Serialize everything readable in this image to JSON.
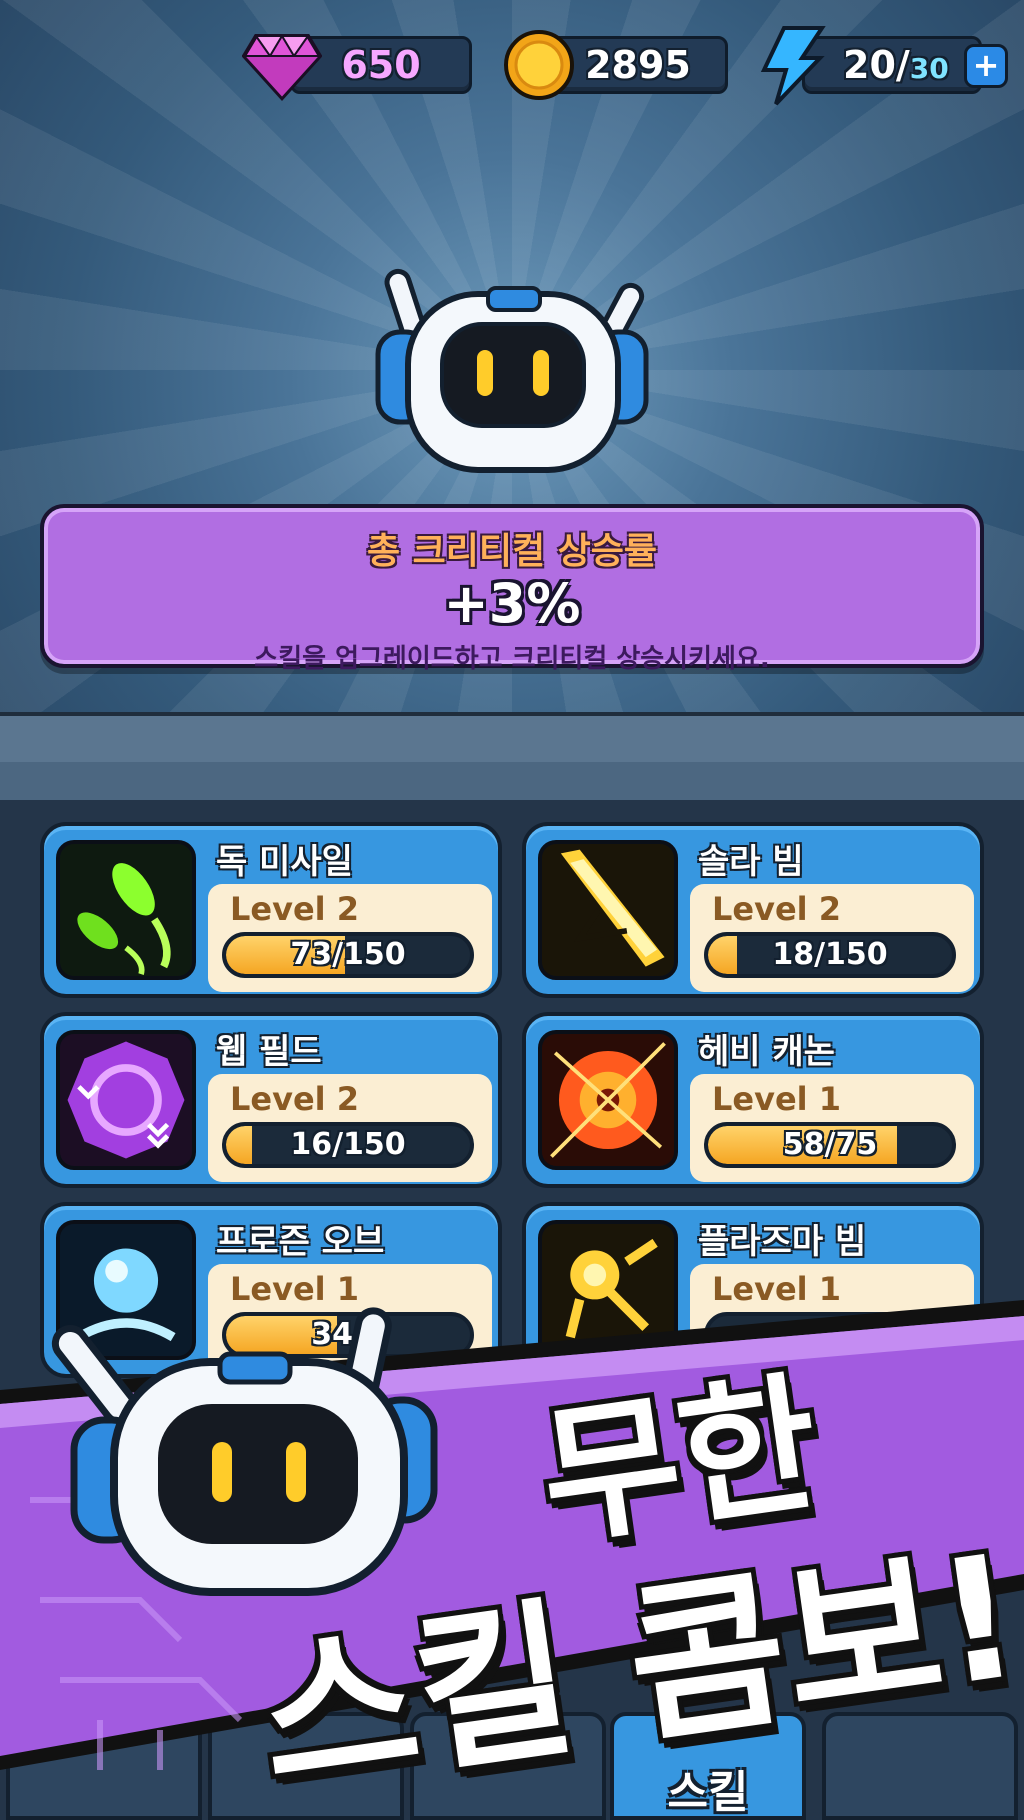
{
  "currency": {
    "gems": "650",
    "coins": "2895",
    "energy_current": "20/",
    "energy_max": "30",
    "plus_label": "+"
  },
  "stat_panel": {
    "title": "총 크리티컬 상승률",
    "value": "+3%",
    "description": "스킬을 업그레이드하고 크리티컬 상승시키세요."
  },
  "skills": [
    {
      "name": "독 미사일",
      "level": "Level 2",
      "progress_text": "73/150",
      "progress_value": 73,
      "progress_max": 150,
      "icon": "poison-missile-icon",
      "color": "#8cff2e"
    },
    {
      "name": "솔라 빔",
      "level": "Level 2",
      "progress_text": "18/150",
      "progress_value": 18,
      "progress_max": 150,
      "icon": "solar-beam-icon",
      "color": "#ffd23a"
    },
    {
      "name": "웹 필드",
      "level": "Level 2",
      "progress_text": "16/150",
      "progress_value": 16,
      "progress_max": 150,
      "icon": "web-field-icon",
      "color": "#c04bff"
    },
    {
      "name": "헤비 캐논",
      "level": "Level 1",
      "progress_text": "58/75",
      "progress_value": 58,
      "progress_max": 75,
      "icon": "heavy-cannon-icon",
      "color": "#ff5a1e"
    },
    {
      "name": "프로즌 오브",
      "level": "Level 1",
      "progress_text": "34/7",
      "progress_value": 34,
      "progress_max": 75,
      "icon": "frozen-orb-icon",
      "color": "#7fd8ff"
    },
    {
      "name": "플라즈마 빔",
      "level": "Level 1",
      "progress_text": "",
      "progress_value": 0,
      "progress_max": 75,
      "icon": "plasma-beam-icon",
      "color": "#ffd23a"
    }
  ],
  "bottom_nav": {
    "active_tab_label": "스킬"
  },
  "banner": {
    "line1": "무한",
    "line2": "스킬 콤보!"
  }
}
